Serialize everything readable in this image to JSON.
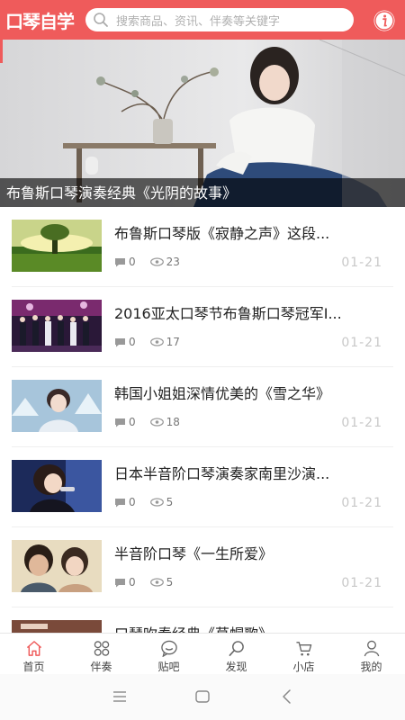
{
  "header": {
    "app_title": "口琴自学",
    "search_placeholder": "搜索商品、资讯、伴奏等关键字",
    "search_icon": "search-icon",
    "info_icon": "info-icon",
    "accent_color": "#ef5b5b"
  },
  "banner": {
    "caption": "布鲁斯口琴演奏经典《光阴的故事》"
  },
  "articles": [
    {
      "title": " 布鲁斯口琴版《寂静之声》这段...",
      "comments": "0",
      "views": "23",
      "date": "01-21"
    },
    {
      "title": "2016亚太口琴节布鲁斯口琴冠军I...",
      "comments": "0",
      "views": "17",
      "date": "01-21"
    },
    {
      "title": "韩国小姐姐深情优美的《雪之华》",
      "comments": "0",
      "views": "18",
      "date": "01-21"
    },
    {
      "title": "日本半音阶口琴演奏家南里沙演...",
      "comments": "0",
      "views": "5",
      "date": "01-21"
    },
    {
      "title": "半音阶口琴《一生所爱》",
      "comments": "0",
      "views": "5",
      "date": "01-21"
    },
    {
      "title": "口琴吹奏经典《草帽歌》",
      "comments": "",
      "views": "",
      "date": ""
    }
  ],
  "tabs": [
    {
      "label": "首页",
      "icon": "home-icon"
    },
    {
      "label": "伴奏",
      "icon": "grid-icon"
    },
    {
      "label": "贴吧",
      "icon": "chat-icon"
    },
    {
      "label": "发现",
      "icon": "discover-icon"
    },
    {
      "label": "小店",
      "icon": "cart-icon"
    },
    {
      "label": "我的",
      "icon": "user-icon"
    }
  ],
  "system_nav": {
    "menu_icon": "menu-icon",
    "home_icon": "square-home-icon",
    "back_icon": "back-icon"
  }
}
